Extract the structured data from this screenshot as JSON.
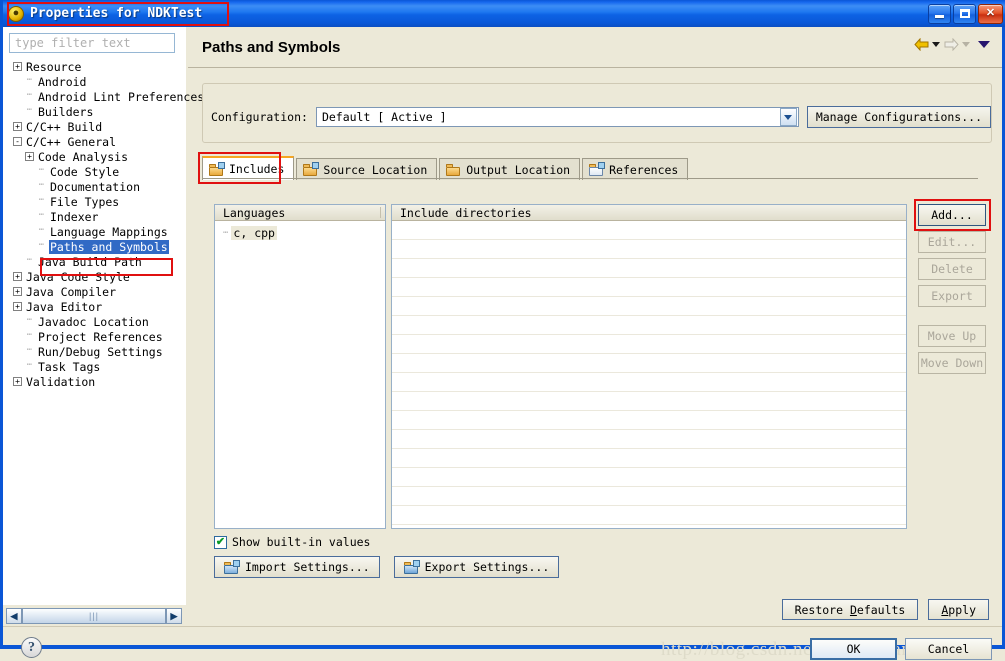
{
  "window": {
    "title": "Properties for NDKTest",
    "icon": "eclipse-circle-icon",
    "controls": {
      "minimize": "minimize-button",
      "maximize": "maximize-button",
      "close": "close-button"
    }
  },
  "sidebar": {
    "filter": {
      "placeholder": "type filter text",
      "value": ""
    },
    "tree": [
      {
        "label": "Resource",
        "toggle": "+",
        "indent": 0,
        "selected": false
      },
      {
        "label": "Android",
        "toggle": "",
        "indent": 1,
        "selected": false
      },
      {
        "label": "Android Lint Preferences",
        "toggle": "",
        "indent": 1,
        "selected": false
      },
      {
        "label": "Builders",
        "toggle": "",
        "indent": 1,
        "selected": false
      },
      {
        "label": "C/C++ Build",
        "toggle": "+",
        "indent": 0,
        "selected": false
      },
      {
        "label": "C/C++ General",
        "toggle": "-",
        "indent": 0,
        "selected": false
      },
      {
        "label": "Code Analysis",
        "toggle": "+",
        "indent": 1,
        "selected": false
      },
      {
        "label": "Code Style",
        "toggle": "",
        "indent": 2,
        "selected": false
      },
      {
        "label": "Documentation",
        "toggle": "",
        "indent": 2,
        "selected": false
      },
      {
        "label": "File Types",
        "toggle": "",
        "indent": 2,
        "selected": false
      },
      {
        "label": "Indexer",
        "toggle": "",
        "indent": 2,
        "selected": false
      },
      {
        "label": "Language Mappings",
        "toggle": "",
        "indent": 2,
        "selected": false
      },
      {
        "label": "Paths and Symbols",
        "toggle": "",
        "indent": 2,
        "selected": true
      },
      {
        "label": "Java Build Path",
        "toggle": "",
        "indent": 1,
        "selected": false
      },
      {
        "label": "Java Code Style",
        "toggle": "+",
        "indent": 0,
        "selected": false
      },
      {
        "label": "Java Compiler",
        "toggle": "+",
        "indent": 0,
        "selected": false
      },
      {
        "label": "Java Editor",
        "toggle": "+",
        "indent": 0,
        "selected": false
      },
      {
        "label": "Javadoc Location",
        "toggle": "",
        "indent": 1,
        "selected": false
      },
      {
        "label": "Project References",
        "toggle": "",
        "indent": 1,
        "selected": false
      },
      {
        "label": "Run/Debug Settings",
        "toggle": "",
        "indent": 1,
        "selected": false
      },
      {
        "label": "Task Tags",
        "toggle": "",
        "indent": 1,
        "selected": false
      },
      {
        "label": "Validation",
        "toggle": "+",
        "indent": 0,
        "selected": false
      }
    ],
    "scroll_left": "◀",
    "scroll_right": "▶",
    "help": "?"
  },
  "page": {
    "title": "Paths and Symbols",
    "nav": {
      "back": "back-arrow-icon",
      "forward": "forward-arrow-icon",
      "menu": "view-menu-caret"
    },
    "configuration": {
      "label": "Configuration:",
      "value": "Default  [ Active ]",
      "manage_button": "Manage Configurations..."
    },
    "tabs": [
      {
        "label": "Includes",
        "icon": "folder-includes-icon",
        "active": true
      },
      {
        "label": "Source Location",
        "icon": "folder-source-icon",
        "active": false
      },
      {
        "label": "Output Location",
        "icon": "folder-output-icon",
        "active": false
      },
      {
        "label": "References",
        "icon": "references-icon",
        "active": false
      }
    ],
    "languages_panel": {
      "header": "Languages",
      "items": [
        "c, cpp"
      ]
    },
    "includes_panel": {
      "header": "Include directories",
      "items": []
    },
    "side_buttons": [
      {
        "label": "Add...",
        "enabled": true
      },
      {
        "label": "Edit...",
        "enabled": false
      },
      {
        "label": "Delete",
        "enabled": false
      },
      {
        "label": "Export",
        "enabled": false
      },
      {
        "label": "Move Up",
        "enabled": false,
        "gap": true
      },
      {
        "label": "Move Down",
        "enabled": false
      }
    ],
    "show_builtin": {
      "label": "Show built-in values",
      "checked": true,
      "check_glyph": "✔"
    },
    "import_button": "Import Settings...",
    "export_button": "Export Settings..."
  },
  "footer": {
    "restore_defaults": "Restore Defaults",
    "restore_defaults_mnemonic": "D",
    "apply": "Apply",
    "apply_mnemonic": "A",
    "ok": "OK",
    "cancel": "Cancel",
    "watermark": "http://blog.csdn.net/dong0zhantai"
  },
  "colors": {
    "titlebar_blue": "#0a56d6",
    "highlight_red": "#e01010",
    "selection_blue": "#316ac5",
    "dialog_bg": "#ece9d8",
    "active_tab_accent": "#f5a623"
  }
}
